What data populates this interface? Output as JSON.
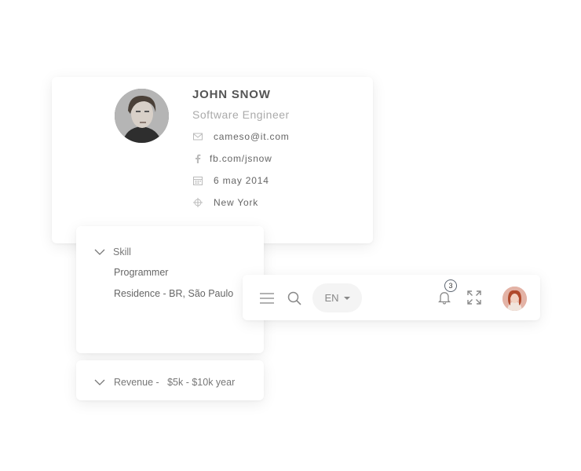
{
  "profile": {
    "name": "JOHN SNOW",
    "role": "Software Engineer",
    "details": [
      {
        "icon": "mail-icon",
        "text": "cameso@it.com"
      },
      {
        "icon": "facebook-icon",
        "text": "fb.com/jsnow"
      },
      {
        "icon": "calendar-icon",
        "text": "6 may 2014"
      },
      {
        "icon": "location-icon",
        "text": "New York"
      }
    ]
  },
  "skill_panel": {
    "title": "Skill",
    "items": [
      "Programmer",
      "Residence - BR, São Paulo"
    ]
  },
  "revenue_panel": {
    "label": "Revenue -   $5k - $10k year"
  },
  "toolbar": {
    "language": "EN",
    "notification_count": "3"
  }
}
